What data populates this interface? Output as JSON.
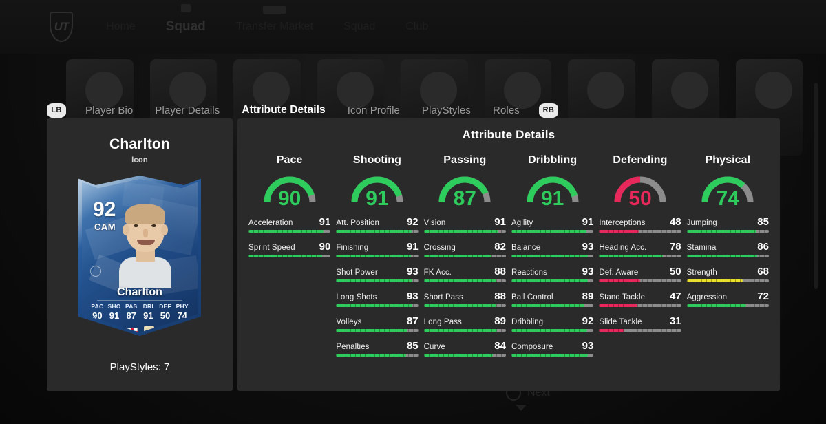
{
  "background": {
    "logo": "UT",
    "nav": [
      {
        "label": "Home",
        "bright": false,
        "pip": ""
      },
      {
        "label": "Squad",
        "bright": true,
        "pip": "single"
      },
      {
        "label": "Transfer Market",
        "bright": false,
        "pip": "double"
      },
      {
        "label": "Squad",
        "bright": false,
        "pip": ""
      },
      {
        "label": "Club",
        "bright": false,
        "pip": ""
      }
    ],
    "next_label": "Next",
    "next_icon": "circle-button-icon"
  },
  "tabbar": {
    "left_bumper": "LB",
    "right_bumper": "RB",
    "tabs": [
      {
        "label": "Player Bio",
        "active": false
      },
      {
        "label": "Player Details",
        "active": false
      },
      {
        "label": "Attribute Details",
        "active": true
      },
      {
        "label": "Icon Profile",
        "active": false
      },
      {
        "label": "PlayStyles",
        "active": false
      },
      {
        "label": "Roles",
        "active": false
      }
    ]
  },
  "player": {
    "name": "Charlton",
    "subtitle": "Icon",
    "playstyles_label": "PlayStyles: 7",
    "card": {
      "rating": "92",
      "position": "CAM",
      "name": "Charlton",
      "nation_icon": "england-flag-icon",
      "club_icon": "club-crest-icon",
      "stats": [
        {
          "key": "PAC",
          "value": "90"
        },
        {
          "key": "SHO",
          "value": "91"
        },
        {
          "key": "PAS",
          "value": "87"
        },
        {
          "key": "DRI",
          "value": "91"
        },
        {
          "key": "DEF",
          "value": "50"
        },
        {
          "key": "PHY",
          "value": "74"
        }
      ]
    }
  },
  "attributes": {
    "title": "Attribute Details",
    "colors": {
      "green": "#2ecc5c",
      "red": "#e8275a",
      "yellow": "#e8e02a",
      "track": "#8c8c8c"
    },
    "columns": [
      {
        "title": "Pace",
        "rating": "90",
        "rating_color": "#2ecc5c",
        "stats": [
          {
            "name": "Acceleration",
            "value": "91",
            "color": "#2ecc5c"
          },
          {
            "name": "Sprint Speed",
            "value": "90",
            "color": "#2ecc5c"
          }
        ]
      },
      {
        "title": "Shooting",
        "rating": "91",
        "rating_color": "#2ecc5c",
        "stats": [
          {
            "name": "Att. Position",
            "value": "92",
            "color": "#2ecc5c"
          },
          {
            "name": "Finishing",
            "value": "91",
            "color": "#2ecc5c"
          },
          {
            "name": "Shot Power",
            "value": "93",
            "color": "#2ecc5c"
          },
          {
            "name": "Long Shots",
            "value": "93",
            "color": "#2ecc5c"
          },
          {
            "name": "Volleys",
            "value": "87",
            "color": "#2ecc5c"
          },
          {
            "name": "Penalties",
            "value": "85",
            "color": "#2ecc5c"
          }
        ]
      },
      {
        "title": "Passing",
        "rating": "87",
        "rating_color": "#2ecc5c",
        "stats": [
          {
            "name": "Vision",
            "value": "91",
            "color": "#2ecc5c"
          },
          {
            "name": "Crossing",
            "value": "82",
            "color": "#2ecc5c"
          },
          {
            "name": "FK Acc.",
            "value": "88",
            "color": "#2ecc5c"
          },
          {
            "name": "Short Pass",
            "value": "88",
            "color": "#2ecc5c"
          },
          {
            "name": "Long Pass",
            "value": "89",
            "color": "#2ecc5c"
          },
          {
            "name": "Curve",
            "value": "84",
            "color": "#2ecc5c"
          }
        ]
      },
      {
        "title": "Dribbling",
        "rating": "91",
        "rating_color": "#2ecc5c",
        "stats": [
          {
            "name": "Agility",
            "value": "91",
            "color": "#2ecc5c"
          },
          {
            "name": "Balance",
            "value": "93",
            "color": "#2ecc5c"
          },
          {
            "name": "Reactions",
            "value": "93",
            "color": "#2ecc5c"
          },
          {
            "name": "Ball Control",
            "value": "89",
            "color": "#2ecc5c"
          },
          {
            "name": "Dribbling",
            "value": "92",
            "color": "#2ecc5c"
          },
          {
            "name": "Composure",
            "value": "93",
            "color": "#2ecc5c"
          }
        ]
      },
      {
        "title": "Defending",
        "rating": "50",
        "rating_color": "#e8275a",
        "stats": [
          {
            "name": "Interceptions",
            "value": "48",
            "color": "#e8275a"
          },
          {
            "name": "Heading Acc.",
            "value": "78",
            "color": "#2ecc5c"
          },
          {
            "name": "Def. Aware",
            "value": "50",
            "color": "#e8275a"
          },
          {
            "name": "Stand Tackle",
            "value": "47",
            "color": "#e8275a"
          },
          {
            "name": "Slide Tackle",
            "value": "31",
            "color": "#e8275a"
          }
        ]
      },
      {
        "title": "Physical",
        "rating": "74",
        "rating_color": "#2ecc5c",
        "stats": [
          {
            "name": "Jumping",
            "value": "85",
            "color": "#2ecc5c"
          },
          {
            "name": "Stamina",
            "value": "86",
            "color": "#2ecc5c"
          },
          {
            "name": "Strength",
            "value": "68",
            "color": "#e8e02a"
          },
          {
            "name": "Aggression",
            "value": "72",
            "color": "#2ecc5c"
          }
        ]
      }
    ]
  }
}
